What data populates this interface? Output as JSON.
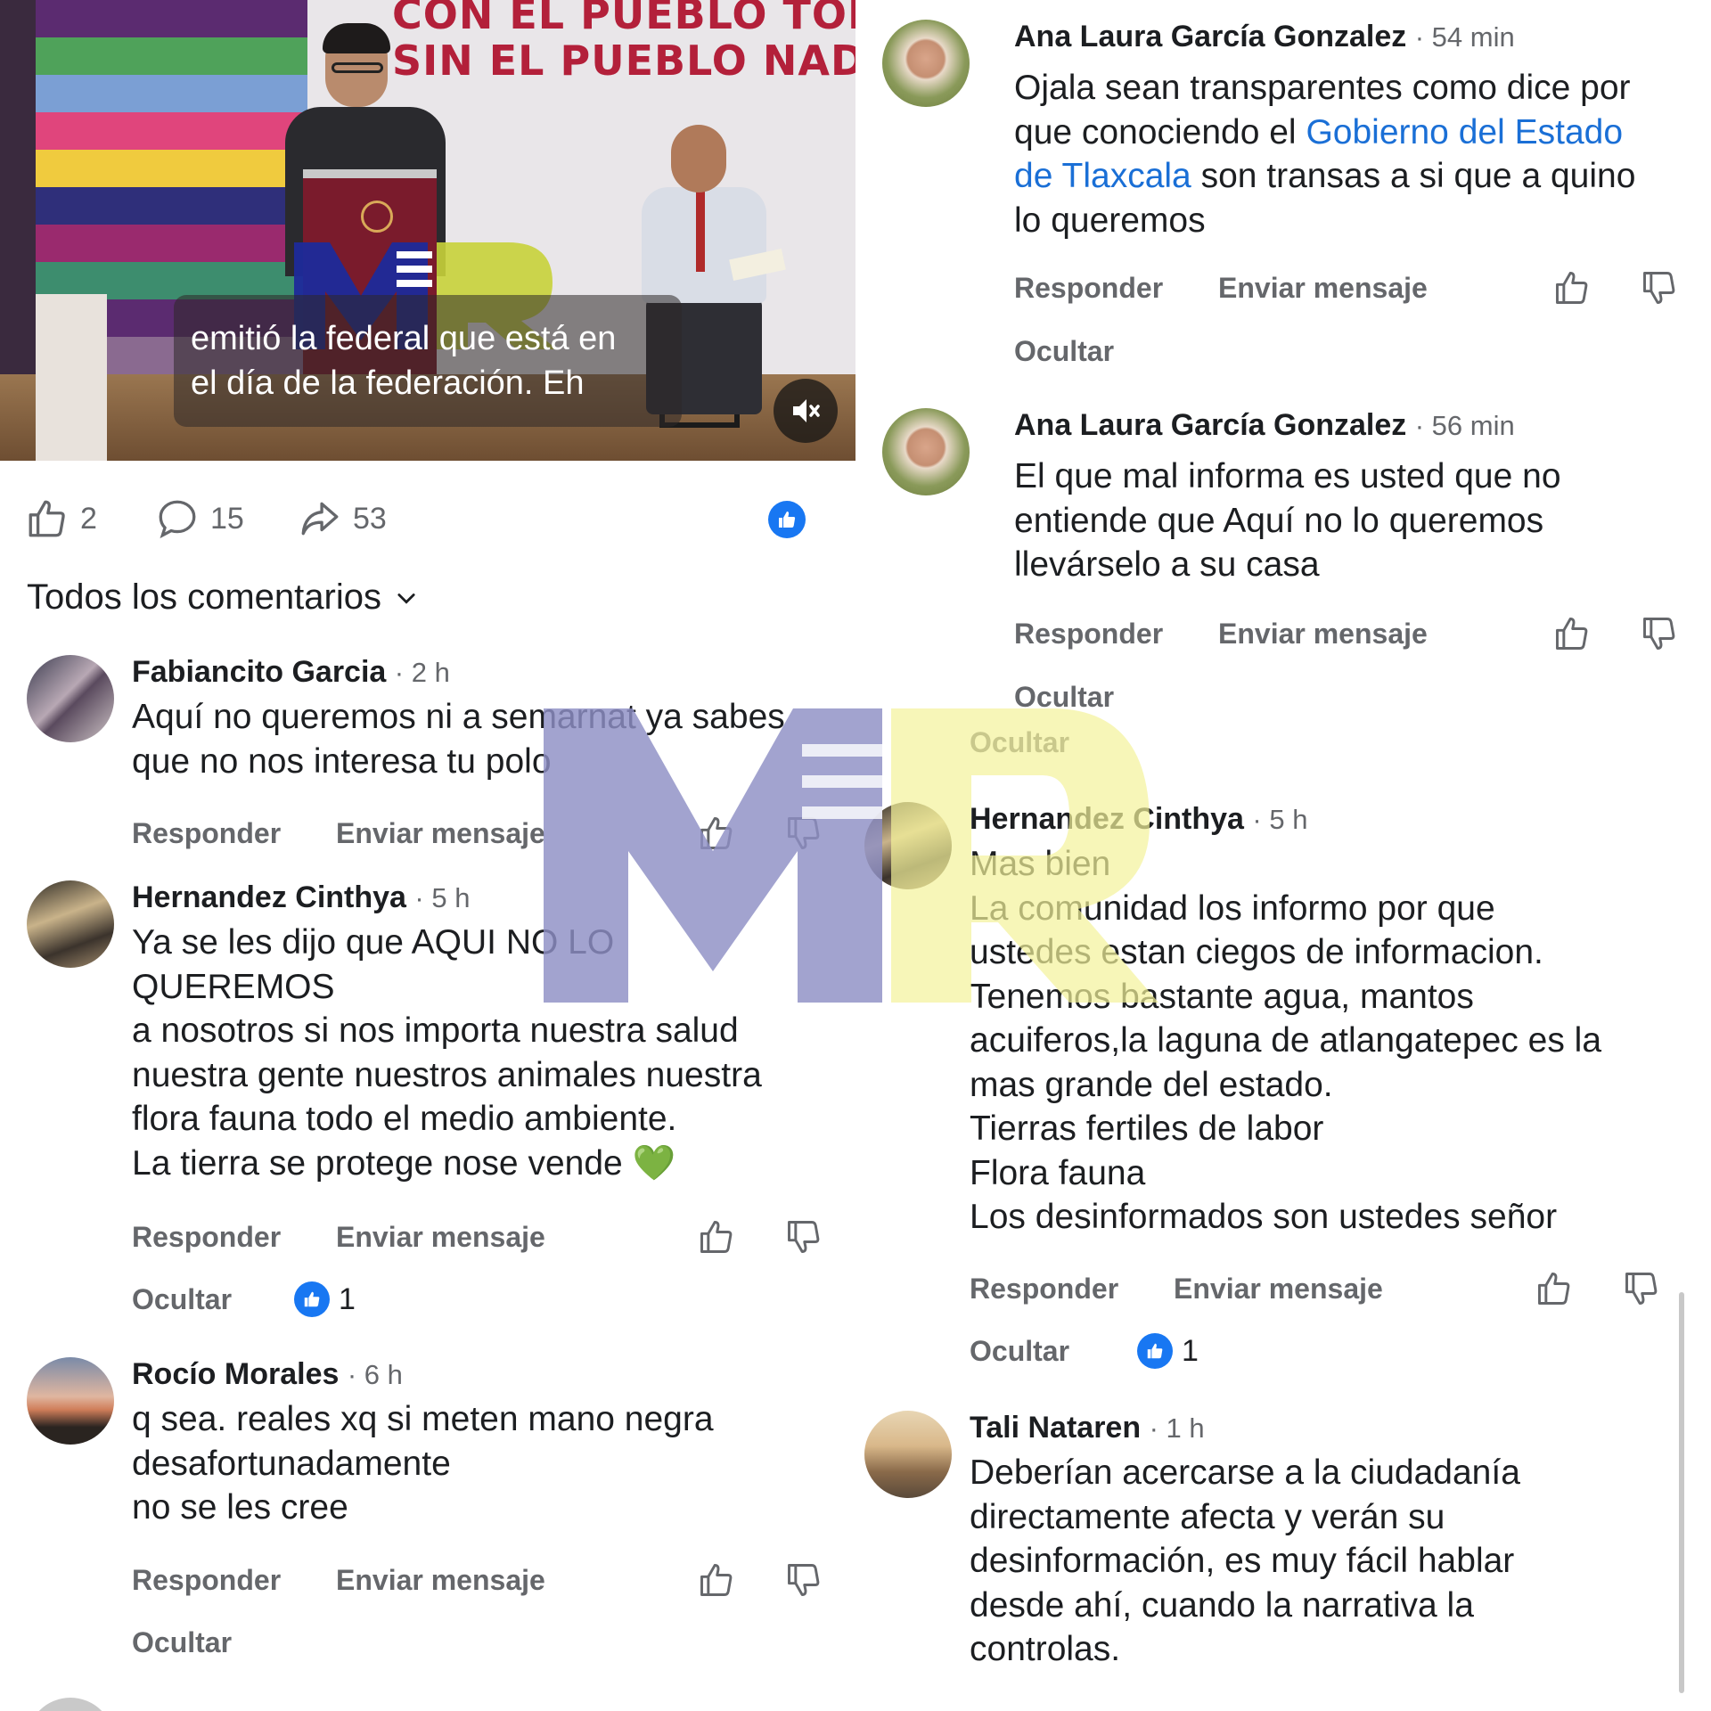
{
  "left": {
    "video": {
      "banner_line1": "CON EL PUEBLO TODO",
      "banner_line2": "SIN EL PUEBLO NADA",
      "subtitle_line1": "emitió la federal que está en",
      "subtitle_line2": "el día de la federación. Eh"
    },
    "actions": {
      "likes": "2",
      "comments": "15",
      "shares": "53"
    },
    "section_title": "Todos los comentarios",
    "comments": [
      {
        "name": "Fabiancito Garcia",
        "time": "· 2 h",
        "text": "Aquí no queremos ni a semarnat ya sabes\nque no nos interesa tu polo",
        "reply": "Responder",
        "message": "Enviar mensaje"
      },
      {
        "name": "Hernandez Cinthya",
        "time": "· 5 h",
        "text": "Ya se les dijo que AQUI NO LO\nQUEREMOS\na nosotros si nos importa nuestra salud\nnuestra gente nuestros animales nuestra\nflora fauna todo el medio ambiente.\nLa tierra se protege nose vende 💚",
        "reply": "Responder",
        "message": "Enviar mensaje",
        "hide": "Ocultar",
        "reactions": "1"
      },
      {
        "name": "Rocío Morales",
        "time": "· 6 h",
        "text": "q sea. reales xq si meten mano negra\ndesafortunadamente\nno se les cree",
        "reply": "Responder",
        "message": "Enviar mensaje",
        "hide": "Ocultar"
      }
    ]
  },
  "right": {
    "comments": [
      {
        "name": "Ana Laura García Gonzalez",
        "time": "· 54 min",
        "text_before": "Ojala sean transparentes como dice por\nque conociendo el ",
        "link": "Gobierno del Estado\nde Tlaxcala",
        "text_after": "  son transas a si que a quino\nlo queremos",
        "reply": "Responder",
        "message": "Enviar mensaje",
        "hide": "Ocultar"
      },
      {
        "name": "Ana Laura García Gonzalez",
        "time": "· 56 min",
        "text": "El que mal informa es usted que no\nentiende que Aquí no lo queremos\nllevárselo a su casa",
        "reply": "Responder",
        "message": "Enviar mensaje",
        "hide": "Ocultar"
      },
      {
        "hide_prev": "Ocultar",
        "name": "Hernandez Cinthya",
        "time": "· 5 h",
        "text": "Mas bien\nLa comunidad los informo por que\nustedes estan ciegos de informacion.\nTenemos bastante agua, mantos\nacuiferos,la laguna de atlangatepec  es la\nmas grande del estado.\nTierras fertiles de labor\nFlora fauna\nLos desinformados son ustedes señor",
        "reply": "Responder",
        "message": "Enviar mensaje",
        "hide": "Ocultar",
        "reactions": "1"
      },
      {
        "name": "Tali Nataren",
        "time": "· 1 h",
        "text": "Deberían acercarse a la ciudadanía\ndirectamente afecta y verán su\ndesinformación, es muy fácil hablar\ndesde ahí, cuando la narrativa la\ncontrolas."
      }
    ]
  },
  "icons": {
    "like": "thumbs-up-icon",
    "dislike": "thumbs-down-icon",
    "comment": "comment-bubble-icon",
    "share": "share-arrow-icon",
    "mute": "speaker-muted-icon",
    "chevron": "chevron-down-icon"
  },
  "colors": {
    "accent": "#1877f2",
    "link": "#1a6fd6",
    "muted_text": "#65676b",
    "watermark_blue": "#8d8fc4",
    "watermark_yellow": "#f3f29a"
  }
}
